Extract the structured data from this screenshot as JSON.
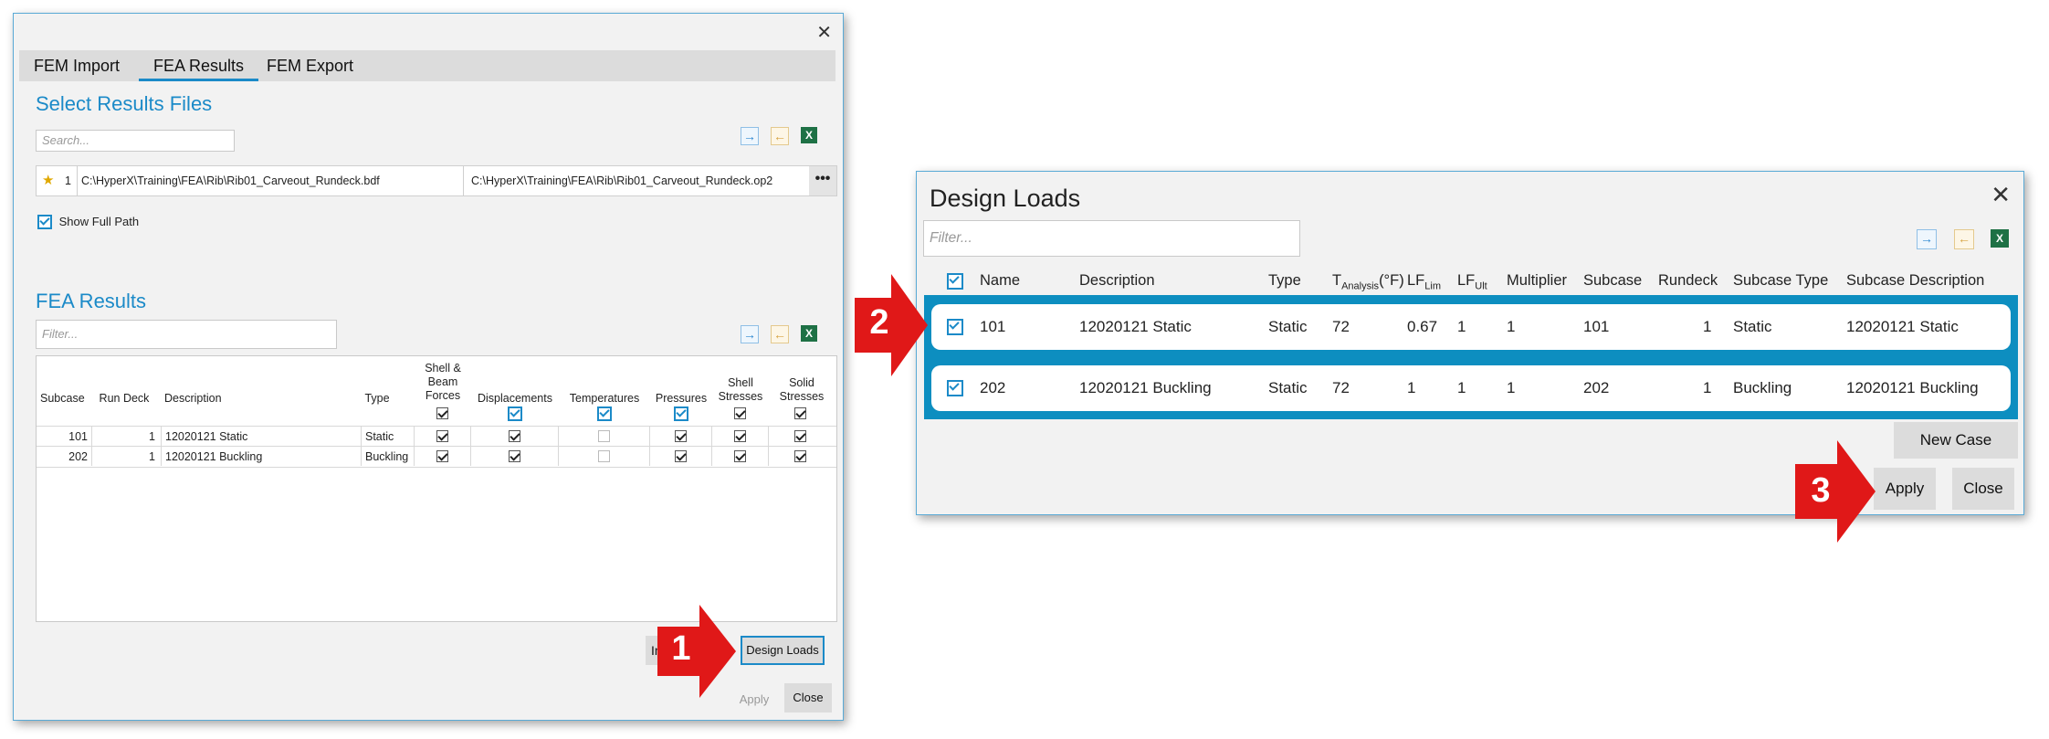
{
  "left_window": {
    "close_glyph": "✕",
    "tabs": [
      "FEM Import",
      "FEA Results",
      "FEM Export"
    ],
    "results_files": {
      "title": "Select Results Files",
      "search_placeholder": "Search...",
      "file": {
        "star": "★",
        "index": "1",
        "fem_path": "C:\\HyperX\\Training\\FEA\\Rib\\Rib01_Carveout_Rundeck.bdf",
        "results_path": "C:\\HyperX\\Training\\FEA\\Rib\\Rib01_Carveout_Rundeck.op2",
        "more": "•••"
      },
      "show_full_path": "Show Full Path"
    },
    "fea_results": {
      "title": "FEA Results",
      "filter_placeholder": "Filter...",
      "columns": [
        "Subcase",
        "Run Deck",
        "Description",
        "Type",
        "Shell &\nBeam\nForces",
        "Displacements",
        "Temperatures",
        "Pressures",
        "Shell\nStresses",
        "Solid\nStresses"
      ],
      "rows": [
        {
          "subcase": "101",
          "run_deck": "1",
          "description": "12020121 Static",
          "type": "Static"
        },
        {
          "subcase": "202",
          "run_deck": "1",
          "description": "12020121 Buckling",
          "type": "Buckling"
        }
      ]
    },
    "buttons": {
      "partial": "In",
      "design_loads": "Design Loads",
      "apply": "Apply",
      "close": "Close"
    }
  },
  "design_loads": {
    "title": "Design Loads",
    "close_glyph": "✕",
    "filter_placeholder": "Filter...",
    "columns": {
      "name": "Name",
      "description": "Description",
      "type": "Type",
      "t_analysis_main": "T",
      "t_analysis_sub": "Analysis",
      "t_analysis_unit": "(°F)",
      "lf_lim_main": "LF",
      "lf_lim_sub": "Lim",
      "lf_ult_main": "LF",
      "lf_ult_sub": "Ult",
      "multiplier": "Multiplier",
      "subcase": "Subcase",
      "rundeck": "Rundeck",
      "subcase_type": "Subcase Type",
      "subcase_description": "Subcase Description"
    },
    "rows": [
      {
        "name": "101",
        "description": "12020121 Static",
        "type": "Static",
        "t_analysis": "72",
        "lf_lim": "0.67",
        "lf_ult": "1",
        "multiplier": "1",
        "subcase": "101",
        "rundeck": "1",
        "subcase_type": "Static",
        "subcase_description": "12020121 Static"
      },
      {
        "name": "202",
        "description": "12020121 Buckling",
        "type": "Static",
        "t_analysis": "72",
        "lf_lim": "1",
        "lf_ult": "1",
        "multiplier": "1",
        "subcase": "202",
        "rundeck": "1",
        "subcase_type": "Buckling",
        "subcase_description": "12020121 Buckling"
      }
    ],
    "buttons": {
      "new_case": "New Case",
      "apply": "Apply",
      "close": "Close"
    }
  },
  "steps": [
    "1",
    "2",
    "3"
  ],
  "colors": {
    "accent": "#1b8ac8",
    "row_band": "#0d8ec0",
    "arrow": "#e01818"
  }
}
